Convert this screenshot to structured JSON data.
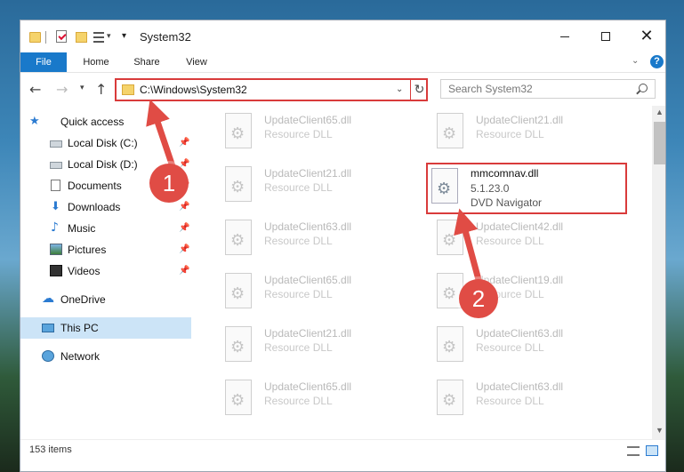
{
  "window": {
    "title": "System32",
    "controls": {
      "minimize_icon": "minimize-icon",
      "maximize_icon": "maximize-icon",
      "close_icon": "close-icon"
    }
  },
  "ribbon": {
    "tabs": [
      "File",
      "Home",
      "Share",
      "View"
    ],
    "help_label": "?"
  },
  "nav": {
    "address": "C:\\Windows\\System32",
    "search_placeholder": "Search System32"
  },
  "sidebar": {
    "items": [
      {
        "label": "Quick access",
        "icon": "star-icon"
      },
      {
        "label": "Local Disk (C:)",
        "icon": "disk-icon",
        "pinned": true
      },
      {
        "label": "Local Disk (D:)",
        "icon": "disk-icon",
        "pinned": true
      },
      {
        "label": "Documents",
        "icon": "documents-icon",
        "pinned": true
      },
      {
        "label": "Downloads",
        "icon": "downloads-icon",
        "pinned": true
      },
      {
        "label": "Music",
        "icon": "music-icon",
        "pinned": true
      },
      {
        "label": "Pictures",
        "icon": "pictures-icon",
        "pinned": true
      },
      {
        "label": "Videos",
        "icon": "videos-icon",
        "pinned": true
      },
      {
        "label": "OneDrive",
        "icon": "cloud-icon"
      },
      {
        "label": "This PC",
        "icon": "pc-icon",
        "selected": true
      },
      {
        "label": "Network",
        "icon": "network-icon"
      }
    ]
  },
  "files": [
    {
      "name": "UpdateClient65.dll",
      "desc": "Resource DLL"
    },
    {
      "name": "UpdateClient21.dll",
      "desc": "Resource DLL"
    },
    {
      "name": "UpdateClient21.dll",
      "desc": "Resource DLL"
    },
    {
      "name": "mmcomnav.dll",
      "desc": "5.1.23.0",
      "extra": "DVD Navigator",
      "highlighted": true
    },
    {
      "name": "UpdateClient63.dll",
      "desc": "Resource DLL"
    },
    {
      "name": "UpdateClient42.dll",
      "desc": "Resource DLL"
    },
    {
      "name": "UpdateClient65.dll",
      "desc": "Resource DLL"
    },
    {
      "name": "UpdateClient19.dll",
      "desc": "Resource DLL"
    },
    {
      "name": "UpdateClient21.dll",
      "desc": "Resource DLL"
    },
    {
      "name": "UpdateClient63.dll",
      "desc": "Resource DLL"
    },
    {
      "name": "UpdateClient65.dll",
      "desc": "Resource DLL"
    },
    {
      "name": "UpdateClient63.dll",
      "desc": "Resource DLL"
    }
  ],
  "status": {
    "count": "153 items"
  },
  "annotations": {
    "step1": "1",
    "step2": "2",
    "accent": "#e04c45"
  },
  "colors": {
    "file_tab": "#1979ca",
    "highlight_border": "#d93b3b",
    "selected_bg": "#cce4f7"
  }
}
